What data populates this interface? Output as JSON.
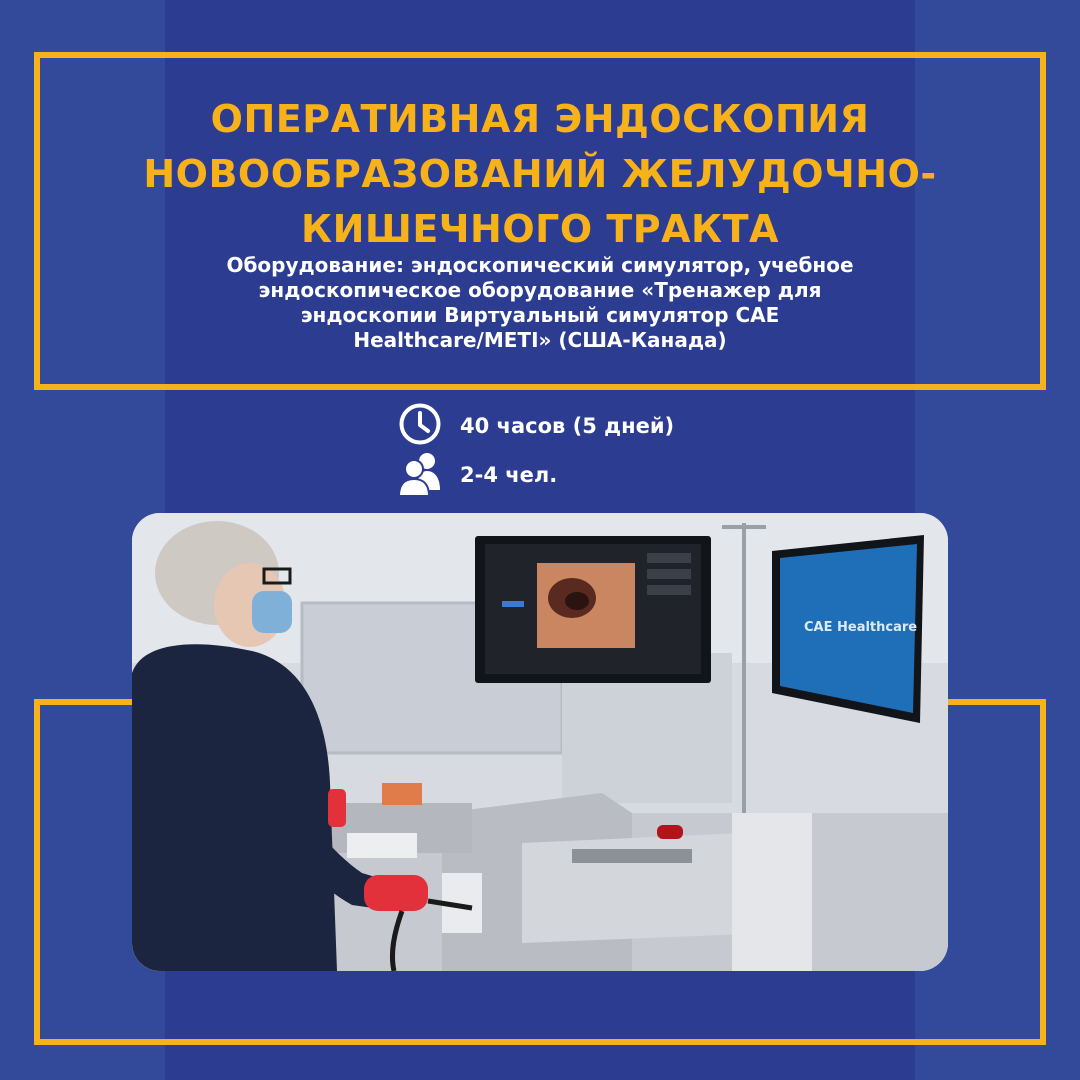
{
  "title": {
    "line1": "ОПЕРАТИВНАЯ ЭНДОСКОПИЯ",
    "line2": "НОВООБРАЗОВАНИЙ ЖЕЛУДОЧНО-",
    "line3": "КИШЕЧНОГО ТРАКТА"
  },
  "subtitle": {
    "line1": "Оборудование: эндоскопический симулятор, учебное",
    "line2": "эндоскопическое оборудование «Тренажер для",
    "line3": "эндоскопии Виртуальный симулятор САЕ",
    "line4": "Healthcare/METI» (США-Канада)"
  },
  "details": {
    "duration": "40 часов (5 дней)",
    "group_size": "2-4 чел."
  },
  "icons": {
    "duration": "clock-icon",
    "group_size": "people-icon"
  },
  "photo": {
    "screen_brand": "CAE Healthcare"
  },
  "colors": {
    "background": "#33499a",
    "center_band": "#2c3c91",
    "accent": "#f7b21a",
    "text": "#ffffff"
  }
}
